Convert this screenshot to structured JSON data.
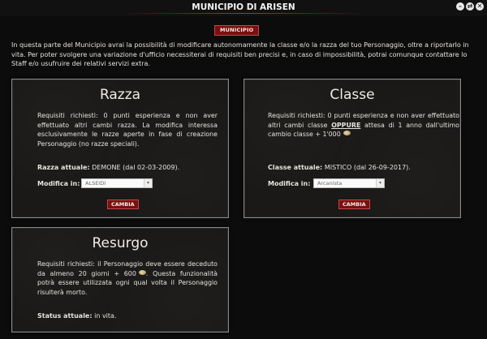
{
  "window": {
    "title": "MUNICIPIO DI ARISEN",
    "controls": {
      "minimize": "–",
      "restore": "⇄",
      "close": "✕"
    }
  },
  "header_button": "MUNICIPIO",
  "intro": "In questa parte del Municipio avrai la possibilità di modificare autonomamente la classe e/o la razza del tuo Personaggio, oltre a riportarlo in vita. Per poter svolgere una variazione d'ufficio necessiterai di requisiti ben precisi e, in caso di impossibilità, potrai comunque contattare lo Staff e/o usufruire dei relativi servizi extra.",
  "razza": {
    "title": "Razza",
    "requirements": "Requisiti richiesti: 0 punti esperienza e non aver effettuato altri cambi razza. La modifica interessa esclusivamente le razze aperte in fase di creazione Personaggio (no razze speciali).",
    "current_label": "Razza attuale:",
    "current_value": "DEMONE (dal 02-03-2009).",
    "modify_label": "Modifica in:",
    "select_value": "ALSEIDI",
    "button": "CAMBIA"
  },
  "classe": {
    "title": "Classe",
    "requirements_a": "Requisiti richiesti: 0 punti esperienza e non aver effettuato altri cambi classe ",
    "requirements_emph": "OPPURE",
    "requirements_b": " attesa di 1 anno dall'ultimo cambio classe + 1'000",
    "current_label": "Classe attuale:",
    "current_value": "MISTICO (dal 26-09-2017).",
    "modify_label": "Modifica in:",
    "select_value": "Arcanista",
    "button": "CAMBIA"
  },
  "resurgo": {
    "title": "Resurgo",
    "requirements_a": "Requisiti richiesti: il Personaggio deve essere deceduto da almeno 20 giorni + 600",
    "requirements_b": ". Questa funzionalità potrà essere utilizzata ogni qual volta il Personaggio risulterà morto.",
    "status_label": "Status attuale:",
    "status_value": "in vita."
  },
  "icons": {
    "coin": "coin-icon",
    "dropdown": "chevron-down-icon"
  },
  "colors": {
    "accent_red": "#7a1010",
    "panel_bg": "#1a1918",
    "border": "#8a8a8a"
  }
}
